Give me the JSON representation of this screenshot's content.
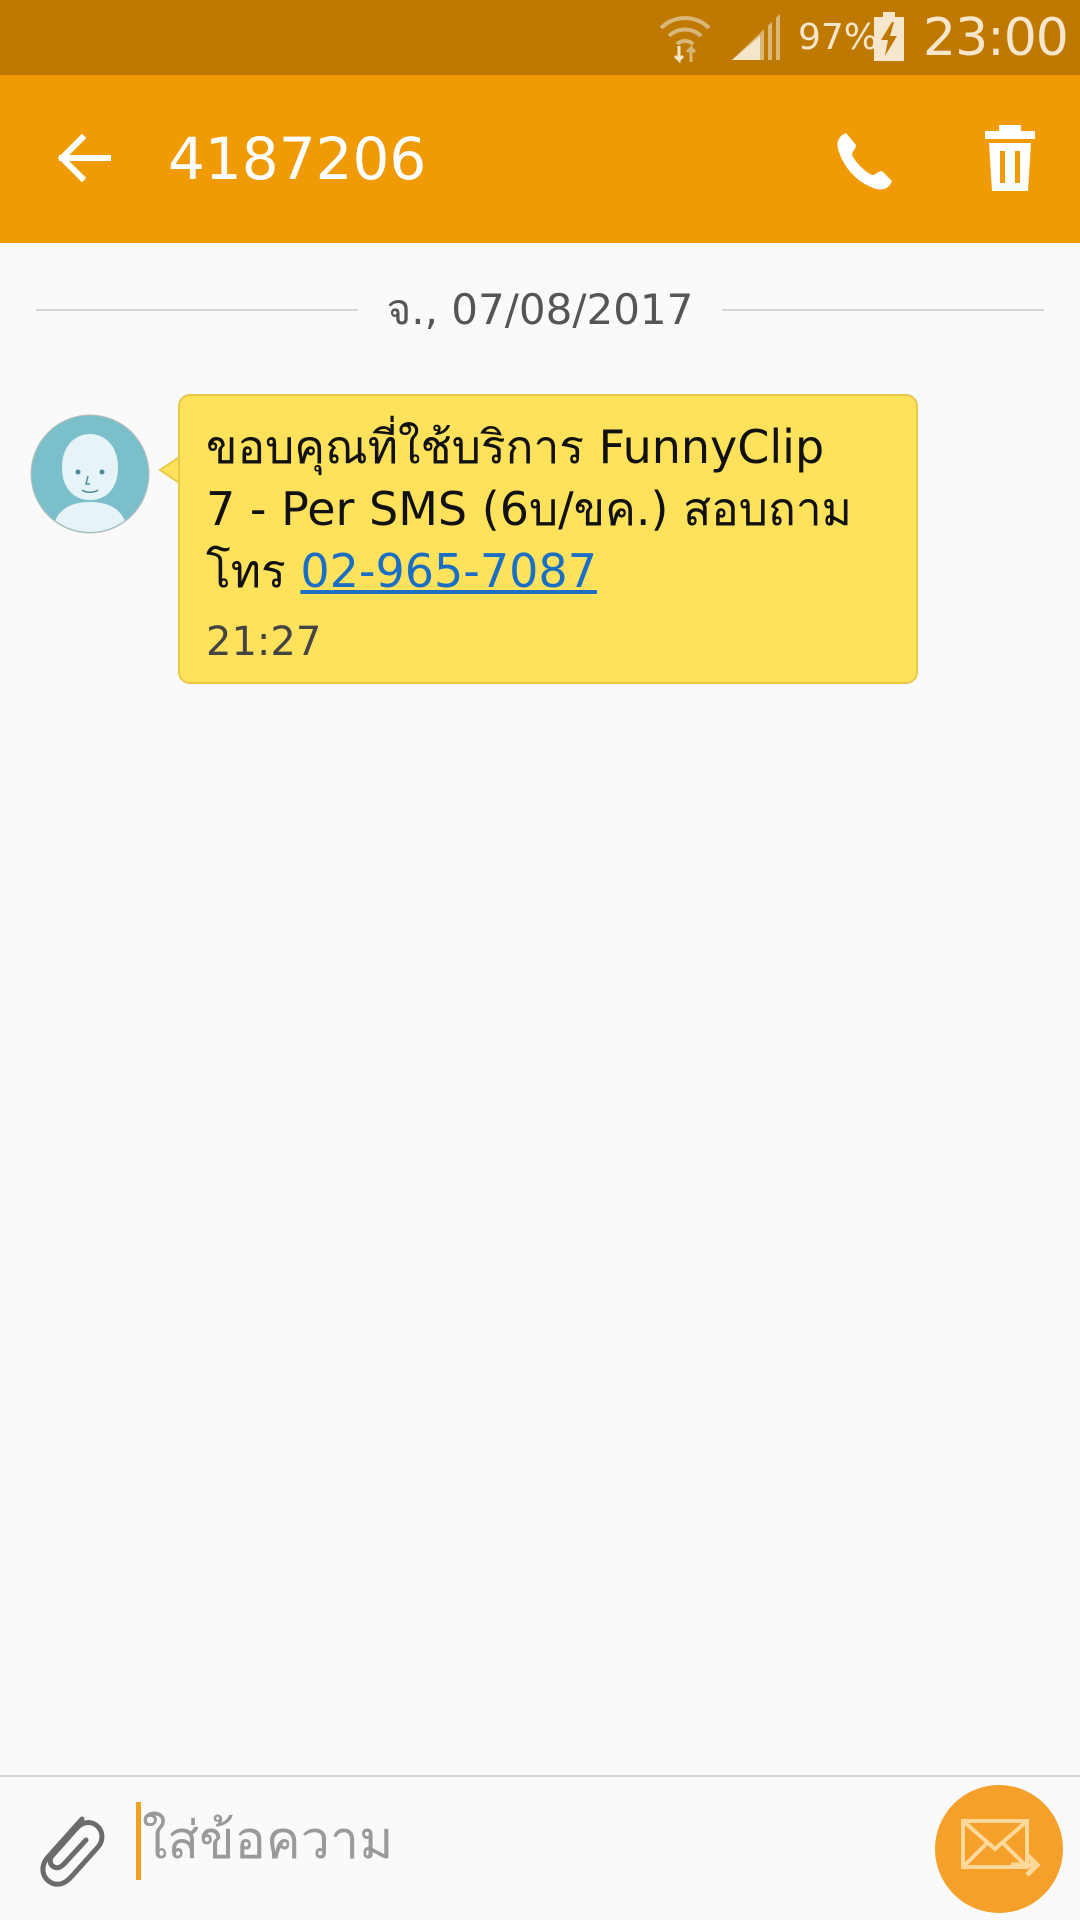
{
  "status_bar": {
    "battery_percent": "97%",
    "time": "23:00",
    "icons": [
      "wifi-icon",
      "signal-icon",
      "battery-charging-icon"
    ]
  },
  "app_bar": {
    "title": "4187206",
    "icons": [
      "back-arrow-icon",
      "phone-icon",
      "trash-icon"
    ]
  },
  "conversation": {
    "date": "จ., 07/08/2017",
    "messages": [
      {
        "lines": [
          "ขอบคุณที่ใช้บริการ FunnyClip",
          "7 - Per SMS (6บ/ขค.) สอบถาม",
          "โทร "
        ],
        "phone_link": "02-965-7087",
        "time": "21:27",
        "avatar_icon": "default-contact-avatar-icon"
      }
    ]
  },
  "composer": {
    "placeholder": "ใส่ข้อความ",
    "value": "",
    "icons": [
      "paperclip-icon",
      "send-envelope-icon"
    ]
  },
  "colors": {
    "status_bar": "#bf7900",
    "app_bar": "#f09b06",
    "bubble": "#ffe25c",
    "link": "#1a6fc4",
    "send_button": "#f4a02a",
    "background": "#fafafa"
  }
}
